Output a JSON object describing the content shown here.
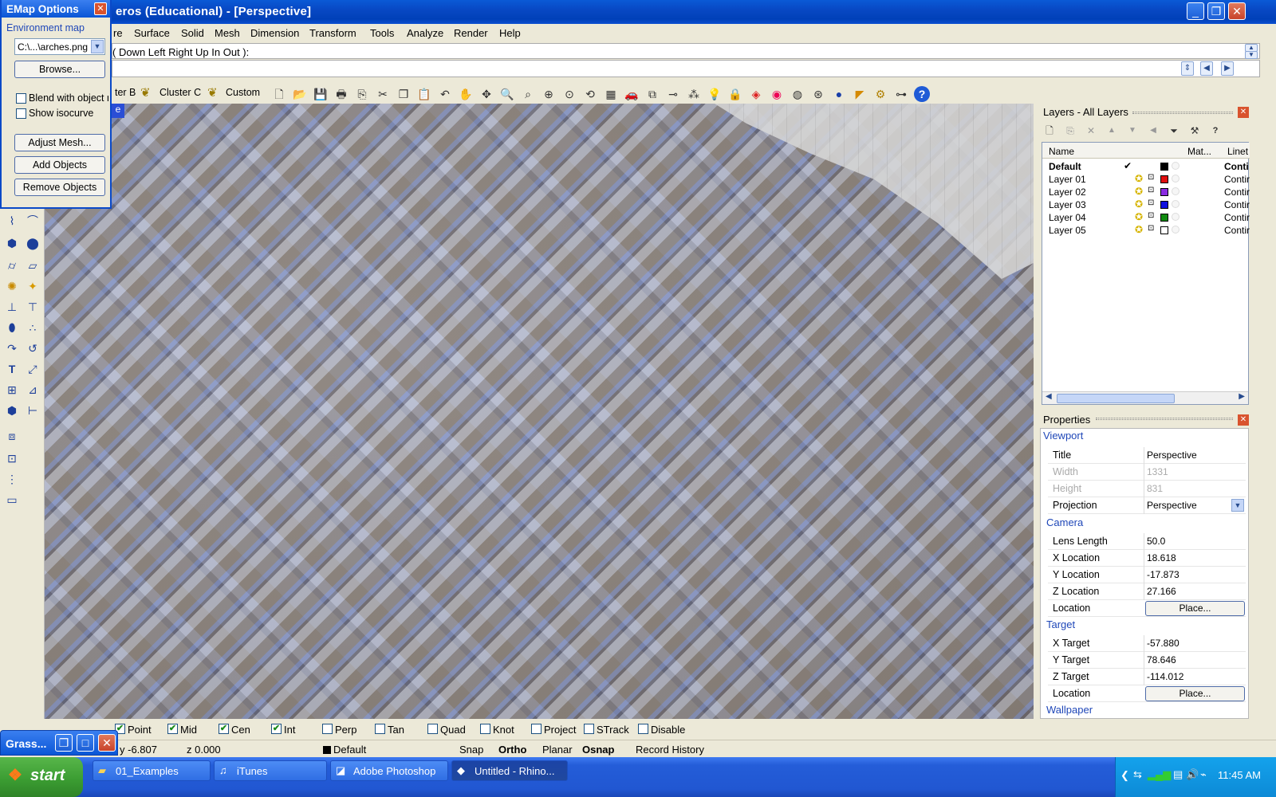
{
  "titlebar": {
    "title": "eros (Educational) - [Perspective]"
  },
  "menu": [
    "re",
    "Surface",
    "Solid",
    "Mesh",
    "Dimension",
    "Transform",
    "Tools",
    "Analyze",
    "Render",
    "Help"
  ],
  "command": {
    "history": "( Down  Left  Right  Up  In  Out ):",
    "current": ""
  },
  "toolbar": {
    "tabs": [
      "ter B",
      "Cluster C",
      "Custom"
    ]
  },
  "viewport": {
    "label": "e"
  },
  "emap": {
    "title": "EMap Options",
    "section": "Environment map",
    "file": "C:\\...\\arches.png",
    "browse": "Browse...",
    "blend_label": "Blend with object r",
    "isocurve_label": "Show isocurve",
    "adjust": "Adjust Mesh...",
    "add": "Add Objects",
    "remove": "Remove Objects"
  },
  "layers": {
    "title": "Layers - All Layers",
    "columns": {
      "name": "Name",
      "mat": "Mat...",
      "linetype": "Linet"
    },
    "rows": [
      {
        "name": "Default",
        "check": "✔",
        "color": "#000000",
        "linetype": "Conti"
      },
      {
        "name": "Layer 01",
        "check": "",
        "color": "#e01010",
        "linetype": "Contir"
      },
      {
        "name": "Layer 02",
        "check": "",
        "color": "#8a2be2",
        "linetype": "Contir"
      },
      {
        "name": "Layer 03",
        "check": "",
        "color": "#1010e0",
        "linetype": "Contir"
      },
      {
        "name": "Layer 04",
        "check": "",
        "color": "#108a10",
        "linetype": "Contir"
      },
      {
        "name": "Layer 05",
        "check": "",
        "color": "#ffffff",
        "linetype": "Contir"
      }
    ]
  },
  "properties": {
    "title": "Properties",
    "viewport_section": "Viewport",
    "title_label": "Title",
    "title_value": "Perspective",
    "width_label": "Width",
    "width_value": "1331",
    "height_label": "Height",
    "height_value": "831",
    "projection_label": "Projection",
    "projection_value": "Perspective",
    "camera_section": "Camera",
    "lens_label": "Lens Length",
    "lens_value": "50.0",
    "xloc_label": "X Location",
    "xloc_value": "18.618",
    "yloc_label": "Y Location",
    "yloc_value": "-17.873",
    "zloc_label": "Z Location",
    "zloc_value": "27.166",
    "location_label": "Location",
    "place_button": "Place...",
    "target_section": "Target",
    "xt_label": "X Target",
    "xt_value": "-57.880",
    "yt_label": "Y Target",
    "yt_value": "78.646",
    "zt_label": "Z Target",
    "zt_value": "-114.012",
    "location2_label": "Location",
    "place2_button": "Place...",
    "wallpaper_section": "Wallpaper"
  },
  "osnap": [
    {
      "label": "Point",
      "checked": true
    },
    {
      "label": "Mid",
      "checked": true
    },
    {
      "label": "Cen",
      "checked": true
    },
    {
      "label": "Int",
      "checked": true
    },
    {
      "label": "Perp",
      "checked": false
    },
    {
      "label": "Tan",
      "checked": false
    },
    {
      "label": "Quad",
      "checked": false
    },
    {
      "label": "Knot",
      "checked": false
    },
    {
      "label": "Project",
      "checked": false
    },
    {
      "label": "STrack",
      "checked": false
    },
    {
      "label": "Disable",
      "checked": false
    }
  ],
  "status": {
    "y": "y -6.807",
    "z": "z 0.000",
    "layer": "Default",
    "snap": "Snap",
    "ortho": "Ortho",
    "planar": "Planar",
    "osnap": "Osnap",
    "record": "Record History"
  },
  "grass": {
    "title": "Grass..."
  },
  "taskbar": {
    "start": "start",
    "tasks": [
      "01_Examples",
      "iTunes",
      "Adobe Photoshop",
      "Untitled - Rhino..."
    ],
    "clock": "11:45 AM"
  }
}
